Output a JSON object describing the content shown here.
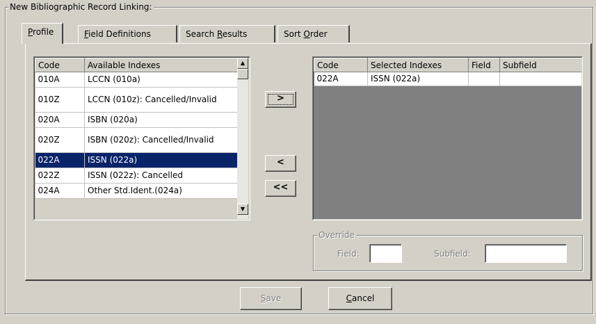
{
  "group": {
    "title": "New Bibliographic Record Linking:"
  },
  "tabs": [
    {
      "label_pre": "",
      "label_u": "P",
      "label_post": "rofile"
    },
    {
      "label_pre": "",
      "label_u": "F",
      "label_post": "ield Definitions"
    },
    {
      "label_pre": "Search ",
      "label_u": "R",
      "label_post": "esults"
    },
    {
      "label_pre": "Sort ",
      "label_u": "O",
      "label_post": "rder"
    }
  ],
  "available": {
    "headers": {
      "code": "Code",
      "index": "Available Indexes"
    },
    "rows": [
      {
        "code": "010A",
        "index": "LCCN (010a)"
      },
      {
        "code": "010Z",
        "index": "LCCN (010z): Cancelled/Invalid"
      },
      {
        "code": "020A",
        "index": "ISBN (020a)"
      },
      {
        "code": "020Z",
        "index": "ISBN (020z): Cancelled/Invalid"
      },
      {
        "code": "022A",
        "index": "ISSN (022a)"
      },
      {
        "code": "022Z",
        "index": "ISSN (022z): Cancelled"
      },
      {
        "code": "024A",
        "index": "Other Std.Ident.(024a)"
      }
    ],
    "selected_index": 4
  },
  "selected": {
    "headers": {
      "code": "Code",
      "index": "Selected Indexes",
      "field": "Field",
      "subfield": "Subfield"
    },
    "rows": [
      {
        "code": "022A",
        "index": "ISSN (022a)",
        "field": "",
        "subfield": ""
      }
    ]
  },
  "move_buttons": {
    "add": ">",
    "remove": "<",
    "remove_all": "<<"
  },
  "override": {
    "title": "Override",
    "field_label": "Field:",
    "field_value": "",
    "subfield_label": "Subfield:",
    "subfield_value": ""
  },
  "actions": {
    "save_u": "S",
    "save_rest": "ave",
    "save_enabled": false,
    "cancel_u": "C",
    "cancel_rest": "ancel"
  }
}
